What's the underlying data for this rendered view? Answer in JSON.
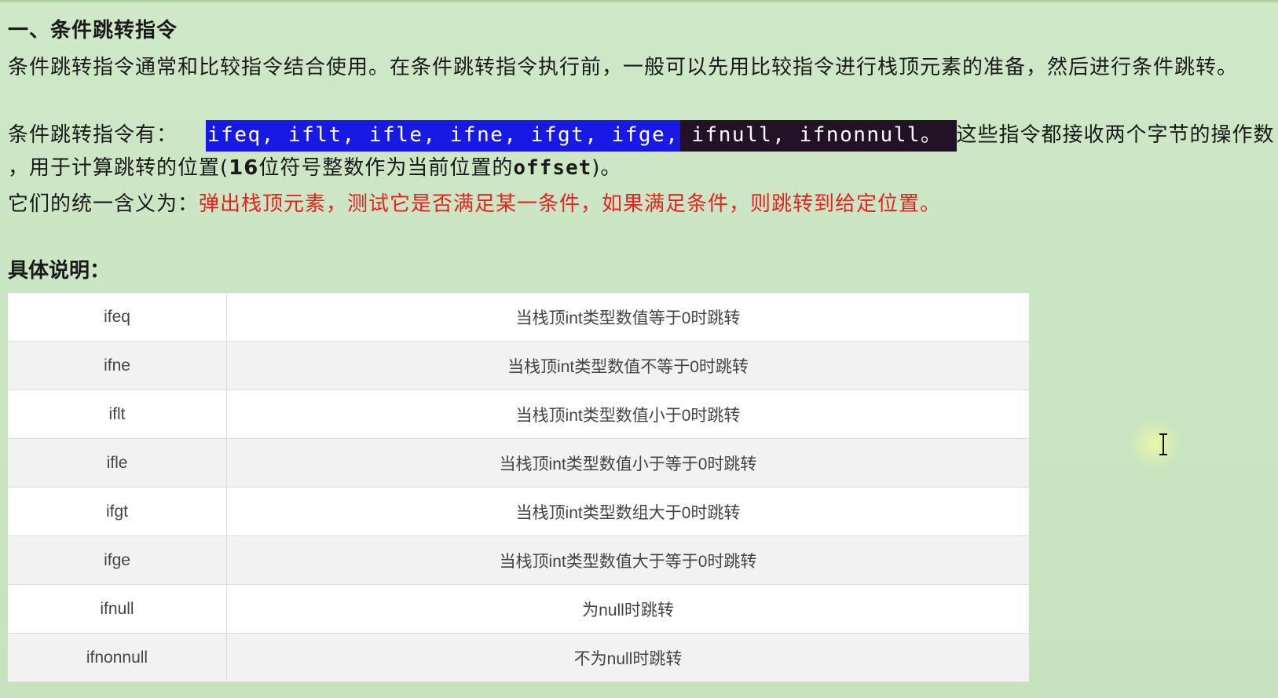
{
  "heading": "一、条件跳转指令",
  "intro": "条件跳转指令通常和比较指令结合使用。在条件跳转指令执行前，一般可以先用比较指令进行栈顶元素的准备，然后进行条件跳转。",
  "instructions_line": {
    "prefix": "条件跳转指令有：",
    "highlighted_blue": "ifeq, iflt, ifle, ifne, ifgt, ifge,",
    "highlighted_dark": "ifnull, ifnonnull。",
    "suffix": "这些指令都接收两个字节的操作数"
  },
  "instructions_line2": {
    "prefix": "，用于计算跳转的位置(",
    "bold_part": "16",
    "middle": "位符号整数作为当前位置的",
    "mono_part": "offset",
    "suffix": ")。"
  },
  "meaning_line": {
    "prefix": "它们的统一含义为：",
    "red_text": "弹出栈顶元素，测试它是否满足某一条件，如果满足条件，则跳转到给定位置。"
  },
  "details_title": "具体说明：",
  "table": {
    "rows": [
      {
        "instr": "ifeq",
        "desc": "当栈顶int类型数值等于0时跳转"
      },
      {
        "instr": "ifne",
        "desc": "当栈顶int类型数值不等于0时跳转"
      },
      {
        "instr": "iflt",
        "desc": "当栈顶int类型数值小于0时跳转"
      },
      {
        "instr": "ifle",
        "desc": "当栈顶int类型数值小于等于0时跳转"
      },
      {
        "instr": "ifgt",
        "desc": "当栈顶int类型数组大于0时跳转"
      },
      {
        "instr": "ifge",
        "desc": "当栈顶int类型数值大于等于0时跳转"
      },
      {
        "instr": "ifnull",
        "desc": "为null时跳转"
      },
      {
        "instr": "ifnonnull",
        "desc": "不为null时跳转"
      }
    ]
  },
  "colors": {
    "background": "#c8e4c0",
    "highlight_blue": "#1919e6",
    "highlight_dark": "#231128",
    "red_text": "#e8231f"
  },
  "icons": {
    "cursor": "text-cursor-icon"
  }
}
